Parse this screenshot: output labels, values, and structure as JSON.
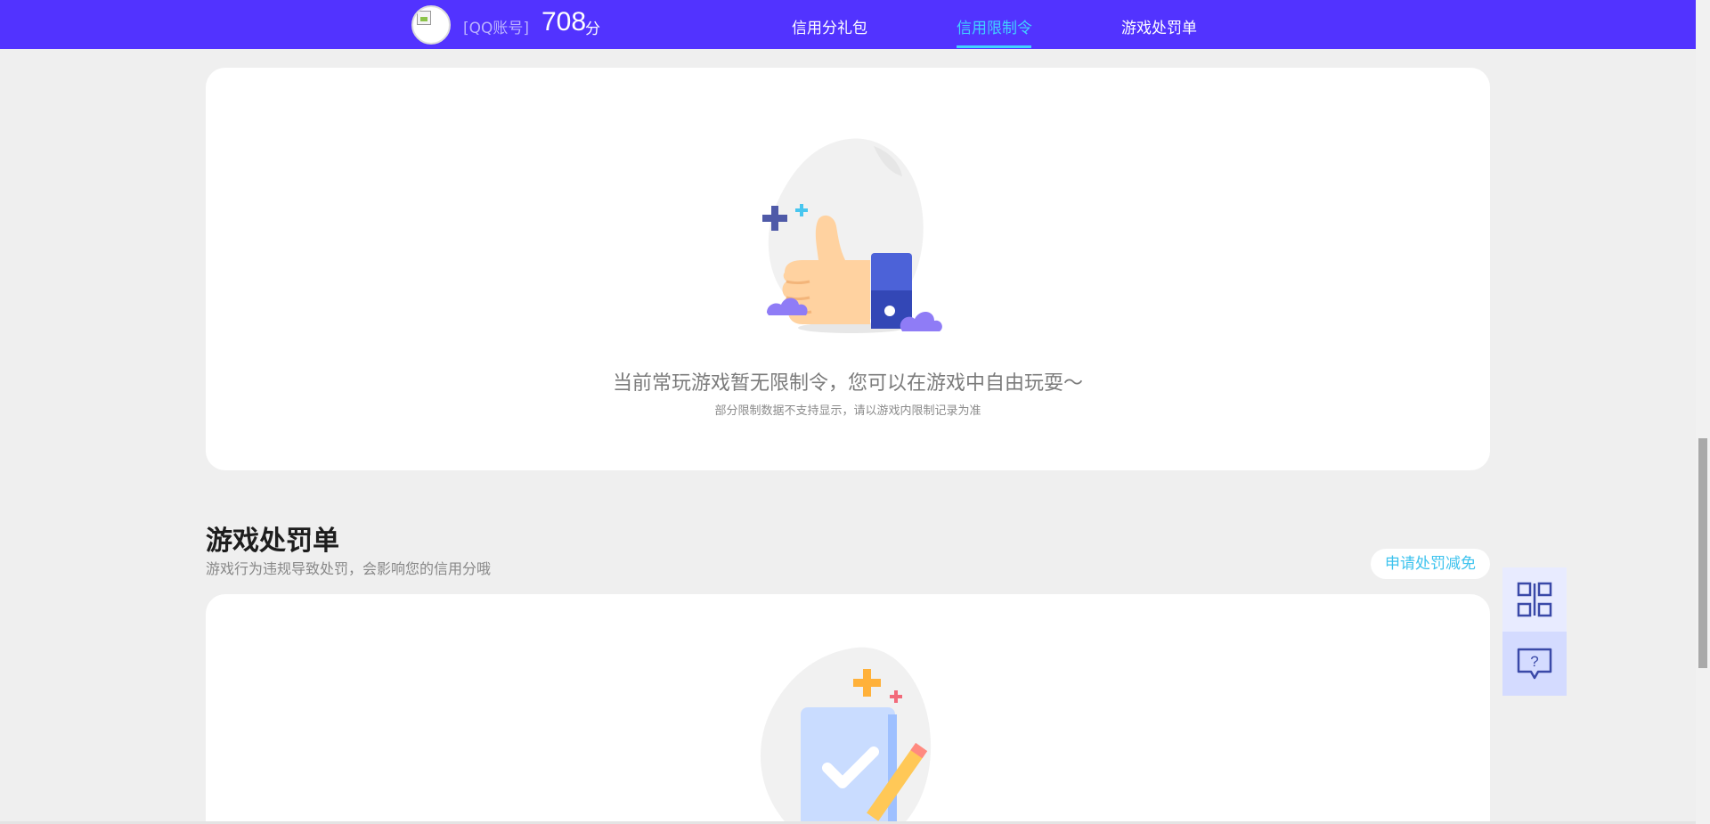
{
  "header": {
    "account_label": "[QQ账号]",
    "score": "708",
    "score_unit": "分",
    "tabs": [
      {
        "label": "信用分礼包"
      },
      {
        "label": "信用限制令"
      },
      {
        "label": "游戏处罚单"
      }
    ],
    "active_tab": "信用限制令",
    "accent_color": "#41d1ff",
    "bar_color": "#5233ff"
  },
  "restriction_card": {
    "message": "当前常玩游戏暂无限制令，您可以在游戏中自由玩耍～",
    "note": "部分限制数据不支持显示，请以游戏内限制记录为准",
    "illustration": "thumbs-up-illustration"
  },
  "penalty_section": {
    "title": "游戏处罚单",
    "subtitle": "游戏行为违规导致处罚，会影响您的信用分哦",
    "apply_button": "申请处罚减免",
    "illustration": "document-check-illustration"
  },
  "side_tools": [
    {
      "icon": "qr-code-icon"
    },
    {
      "icon": "help-chat-icon"
    }
  ]
}
